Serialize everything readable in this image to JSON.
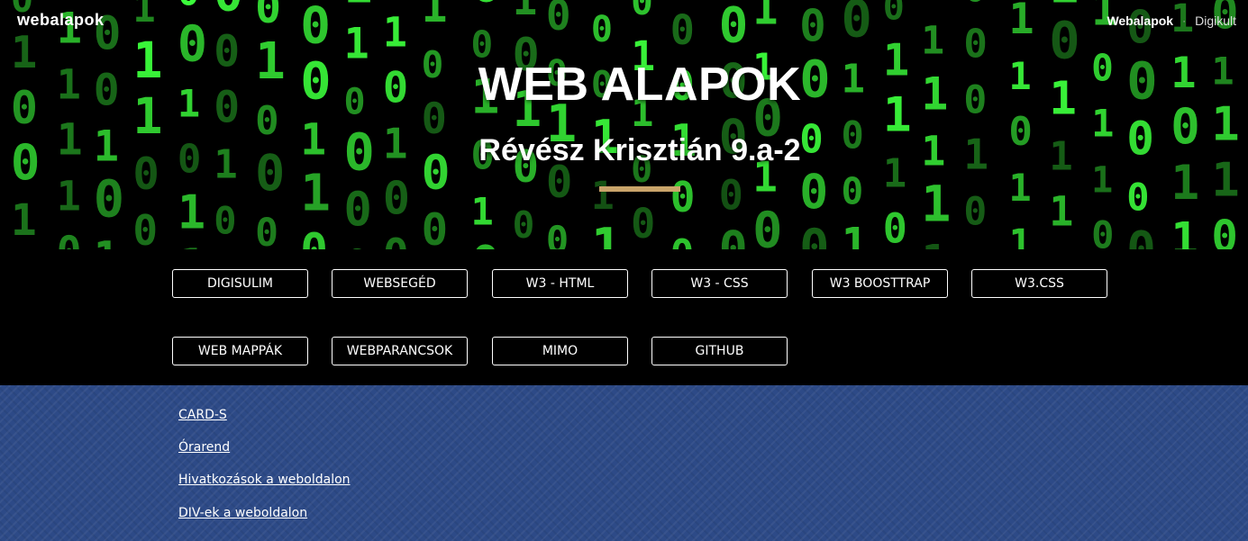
{
  "brand": "webalapok",
  "topnav": {
    "active": "Webalapok",
    "separator": "·",
    "other": "Digikult"
  },
  "hero": {
    "title": "WEB ALAPOK",
    "subtitle": "Révész Krisztián 9.a-2",
    "accent_color": "#c9a46a"
  },
  "buttons": [
    {
      "label": "DIGISULIM"
    },
    {
      "label": "WEBSEGÉD"
    },
    {
      "label": "W3 - HTML"
    },
    {
      "label": "W3 - CSS"
    },
    {
      "label": "W3 BOOSTTRAP"
    },
    {
      "label": "W3.CSS"
    },
    {
      "label": "WEB MAPPÁK"
    },
    {
      "label": "WEBPARANCSOK"
    },
    {
      "label": "MIMO"
    },
    {
      "label": "GITHUB"
    }
  ],
  "links": [
    {
      "label": "CARD-S"
    },
    {
      "label": "Órarend"
    },
    {
      "label": "Hivatkozások a weboldalon"
    },
    {
      "label": "DIV-ek a weboldalon"
    }
  ],
  "colors": {
    "links_background": "#2d4a87",
    "matrix_green": "#3cff3c"
  }
}
